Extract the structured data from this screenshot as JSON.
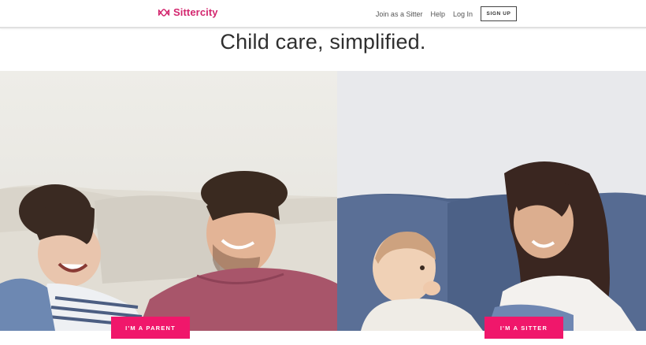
{
  "header": {
    "logo_text": "Sittercity",
    "nav": {
      "join": "Join as a Sitter",
      "help": "Help",
      "login": "Log In",
      "signup": "SIGN UP"
    }
  },
  "hero": {
    "headline": "Child care, simplified."
  },
  "cta": {
    "parent": "I'M A PARENT",
    "sitter": "I'M A SITTER"
  },
  "colors": {
    "brand": "#d3266e",
    "cta": "#f0176b"
  },
  "icons": {
    "logo": "infinity-logo-icon"
  }
}
